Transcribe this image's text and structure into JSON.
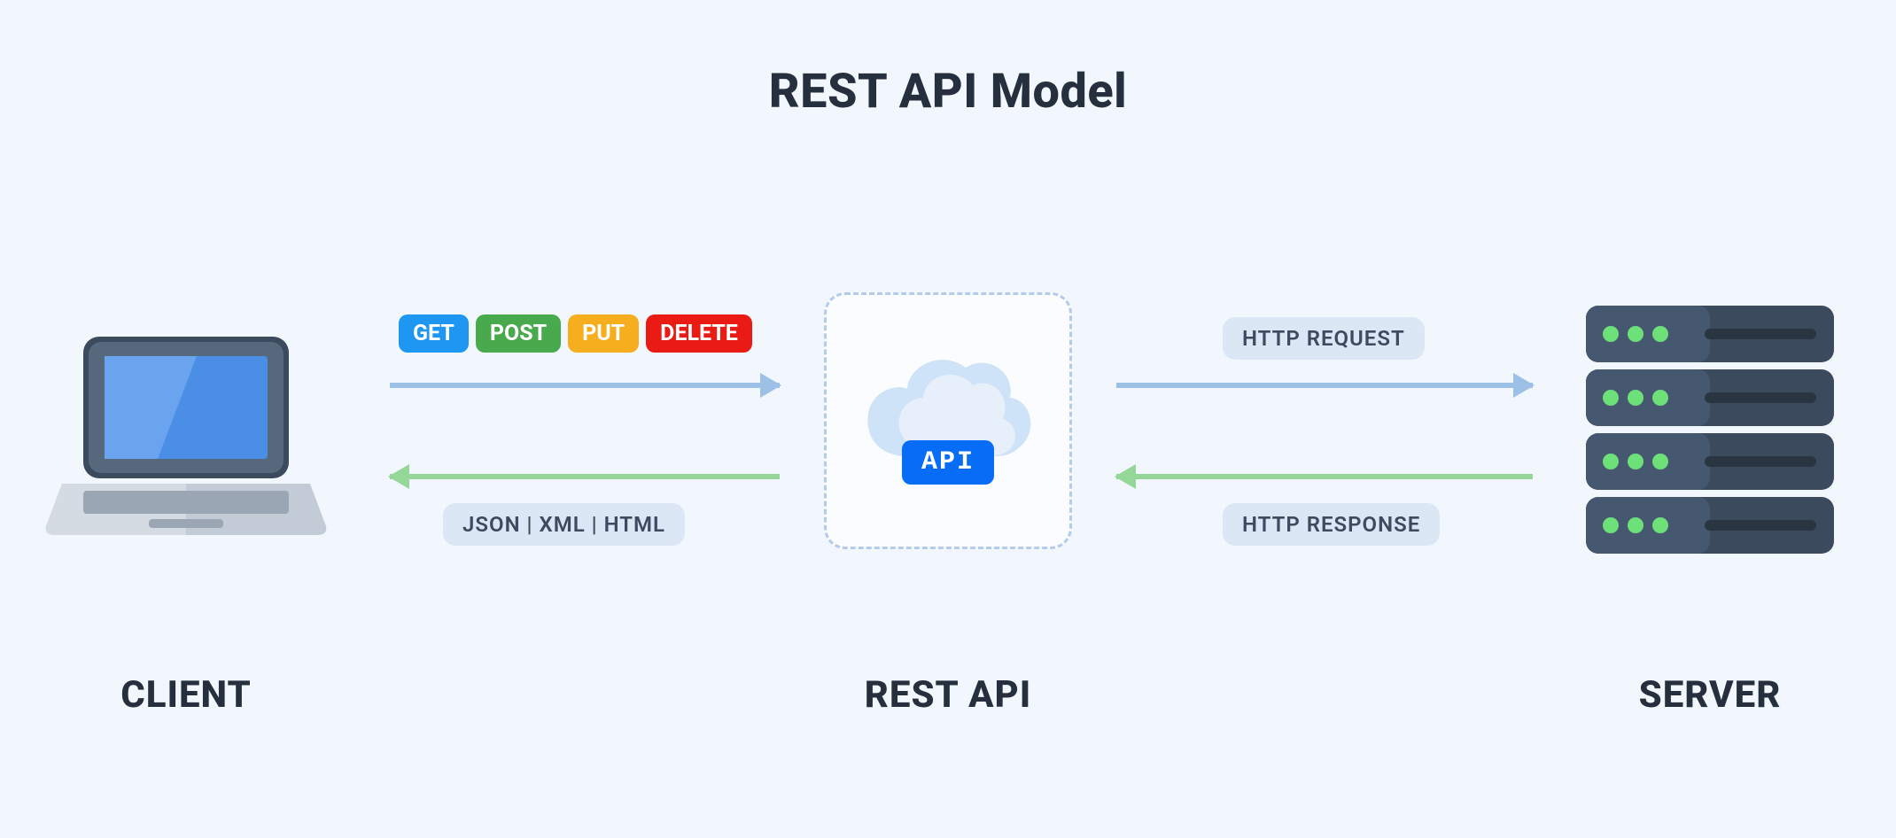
{
  "title": "REST API Model",
  "captions": {
    "client": "CLIENT",
    "api": "REST API",
    "server": "SERVER"
  },
  "methods": [
    {
      "label": "GET",
      "color": "#1e97f2"
    },
    {
      "label": "POST",
      "color": "#49a94d"
    },
    {
      "label": "PUT",
      "color": "#f6ae1e"
    },
    {
      "label": "DELETE",
      "color": "#e91b14"
    }
  ],
  "labels": {
    "request": "HTTP REQUEST",
    "response": "HTTP RESPONSE",
    "formats": "JSON  |  XML  |  HTML"
  },
  "api_tag": "API",
  "colors": {
    "arrow_request": "#9dc1e6",
    "arrow_response": "#95d699",
    "api_tag_bg": "#086df6"
  }
}
